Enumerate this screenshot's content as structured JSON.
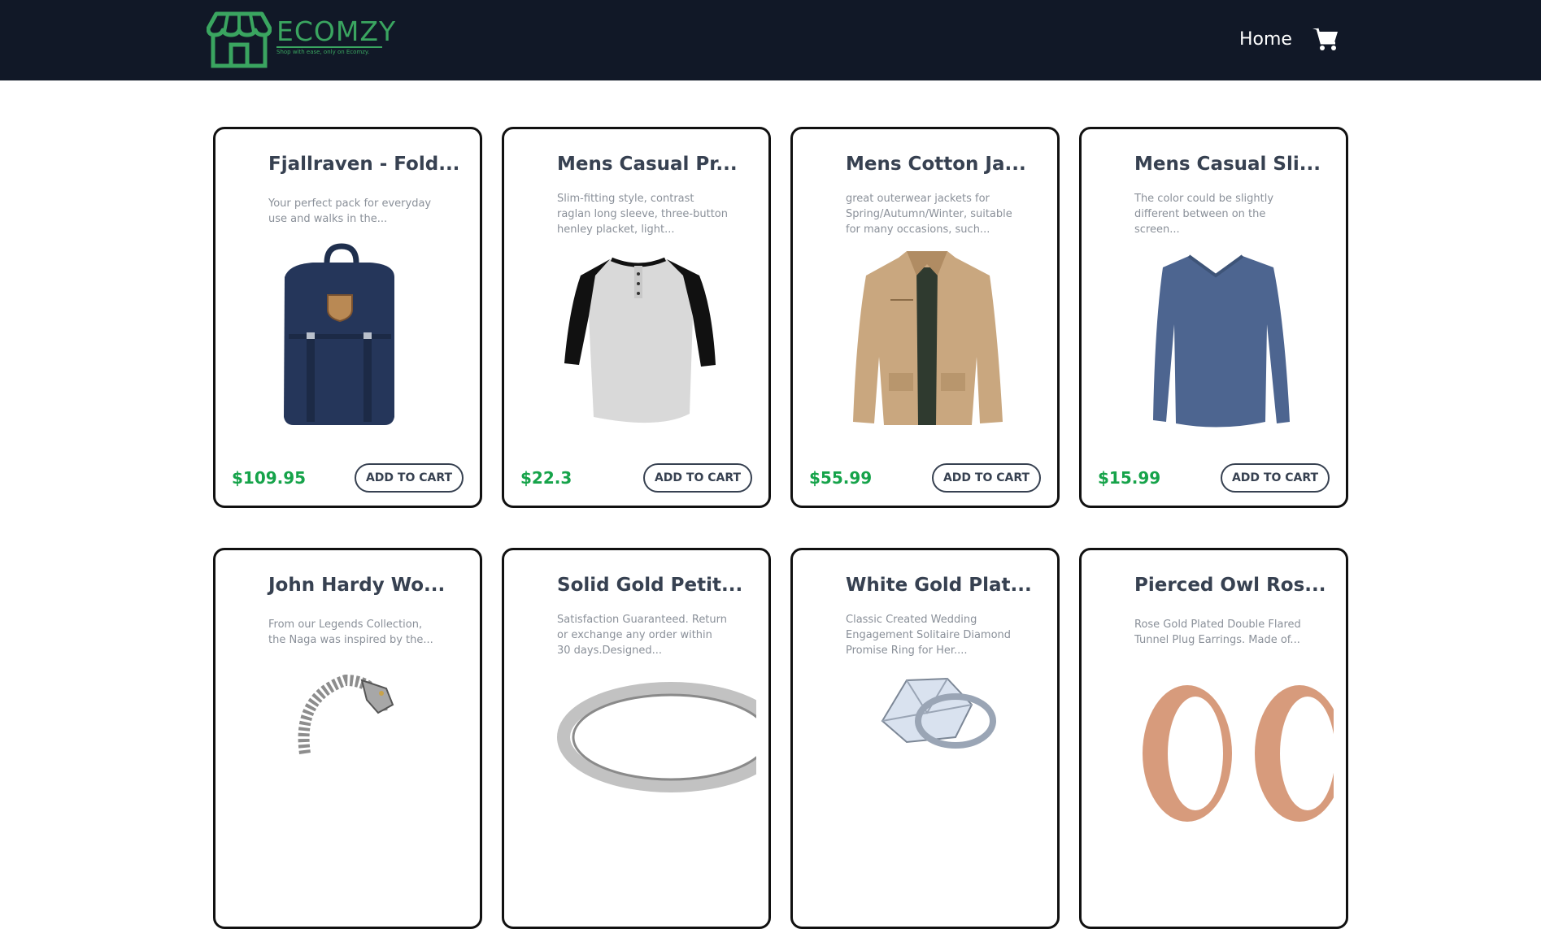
{
  "brand": {
    "name": "ECOMZY",
    "tagline": "Shop with ease, only on Ecomzy.",
    "color": "#3aa560"
  },
  "nav": {
    "home_label": "Home",
    "cart_icon": "shopping-cart-icon"
  },
  "colors": {
    "navbar": "#111827",
    "price": "#16a34a"
  },
  "products": [
    {
      "title": "Fjallraven - Fold...",
      "description": "Your perfect pack for everyday use and walks in the...",
      "price": "$109.95",
      "button": "ADD TO CART",
      "image": "backpack"
    },
    {
      "title": "Mens Casual Pr...",
      "description": "Slim-fitting style, contrast raglan long sleeve, three-button henley placket, light...",
      "price": "$22.3",
      "button": "ADD TO CART",
      "image": "raglan-shirt"
    },
    {
      "title": "Mens Cotton Ja...",
      "description": "great outerwear jackets for Spring/Autumn/Winter, suitable for many occasions, such...",
      "price": "$55.99",
      "button": "ADD TO CART",
      "image": "cotton-jacket"
    },
    {
      "title": "Mens Casual Sli...",
      "description": "The color could be slightly different between on the screen...",
      "price": "$15.99",
      "button": "ADD TO CART",
      "image": "long-sleeve-shirt"
    },
    {
      "title": "John Hardy Wo...",
      "description": "From our Legends Collection, the Naga was inspired by the...",
      "image": "dragon-bracelet"
    },
    {
      "title": "Solid Gold Petit...",
      "description": "Satisfaction Guaranteed. Return or exchange any order within 30 days.Designed...",
      "image": "gold-ring"
    },
    {
      "title": "White Gold Plat...",
      "description": "Classic Created Wedding Engagement Solitaire Diamond Promise Ring for Her....",
      "image": "diamond-ring"
    },
    {
      "title": "Pierced Owl Ros...",
      "description": "Rose Gold Plated Double Flared Tunnel Plug Earrings. Made of...",
      "image": "rose-gold-plugs"
    }
  ]
}
